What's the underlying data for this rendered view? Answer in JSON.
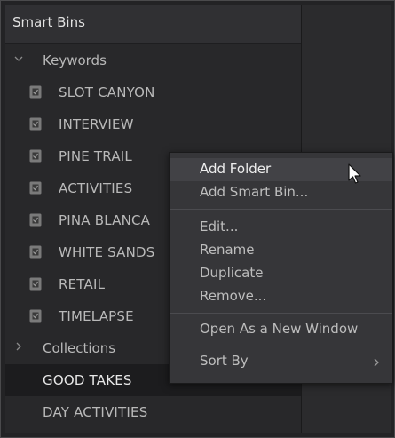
{
  "panel": {
    "title": "Smart Bins"
  },
  "tree": {
    "keywords": {
      "label": "Keywords",
      "expanded": true,
      "icon": "chevron-down-icon"
    },
    "keyword_items": [
      {
        "label": "SLOT CANYON",
        "icon": "smart-bin-icon"
      },
      {
        "label": "INTERVIEW",
        "icon": "smart-bin-icon"
      },
      {
        "label": "PINE TRAIL",
        "icon": "smart-bin-icon"
      },
      {
        "label": "ACTIVITIES",
        "icon": "smart-bin-icon"
      },
      {
        "label": "PINA BLANCA",
        "icon": "smart-bin-icon"
      },
      {
        "label": "WHITE SANDS",
        "icon": "smart-bin-icon"
      },
      {
        "label": "RETAIL",
        "icon": "smart-bin-icon"
      },
      {
        "label": "TIMELAPSE",
        "icon": "smart-bin-icon"
      }
    ],
    "collections": {
      "label": "Collections",
      "expanded": false,
      "icon": "chevron-right-icon"
    },
    "collection_items": [
      {
        "label": "GOOD TAKES",
        "selected": true
      },
      {
        "label": "DAY ACTIVITIES",
        "selected": false
      }
    ]
  },
  "context_menu": {
    "items": [
      {
        "label": "Add Folder",
        "highlighted": true
      },
      {
        "label": "Add Smart Bin..."
      },
      {
        "label": "Edit..."
      },
      {
        "label": "Rename"
      },
      {
        "label": "Duplicate"
      },
      {
        "label": "Remove..."
      },
      {
        "label": "Open As a New Window"
      },
      {
        "label": "Sort By",
        "submenu_icon": "chevron-right-icon"
      }
    ]
  },
  "colors": {
    "background": "#28282a",
    "header": "#303033",
    "selected_row": "#1c1c1e",
    "menu": "#363639",
    "menu_highlight": "#424246",
    "text": "#b9b9b9"
  }
}
